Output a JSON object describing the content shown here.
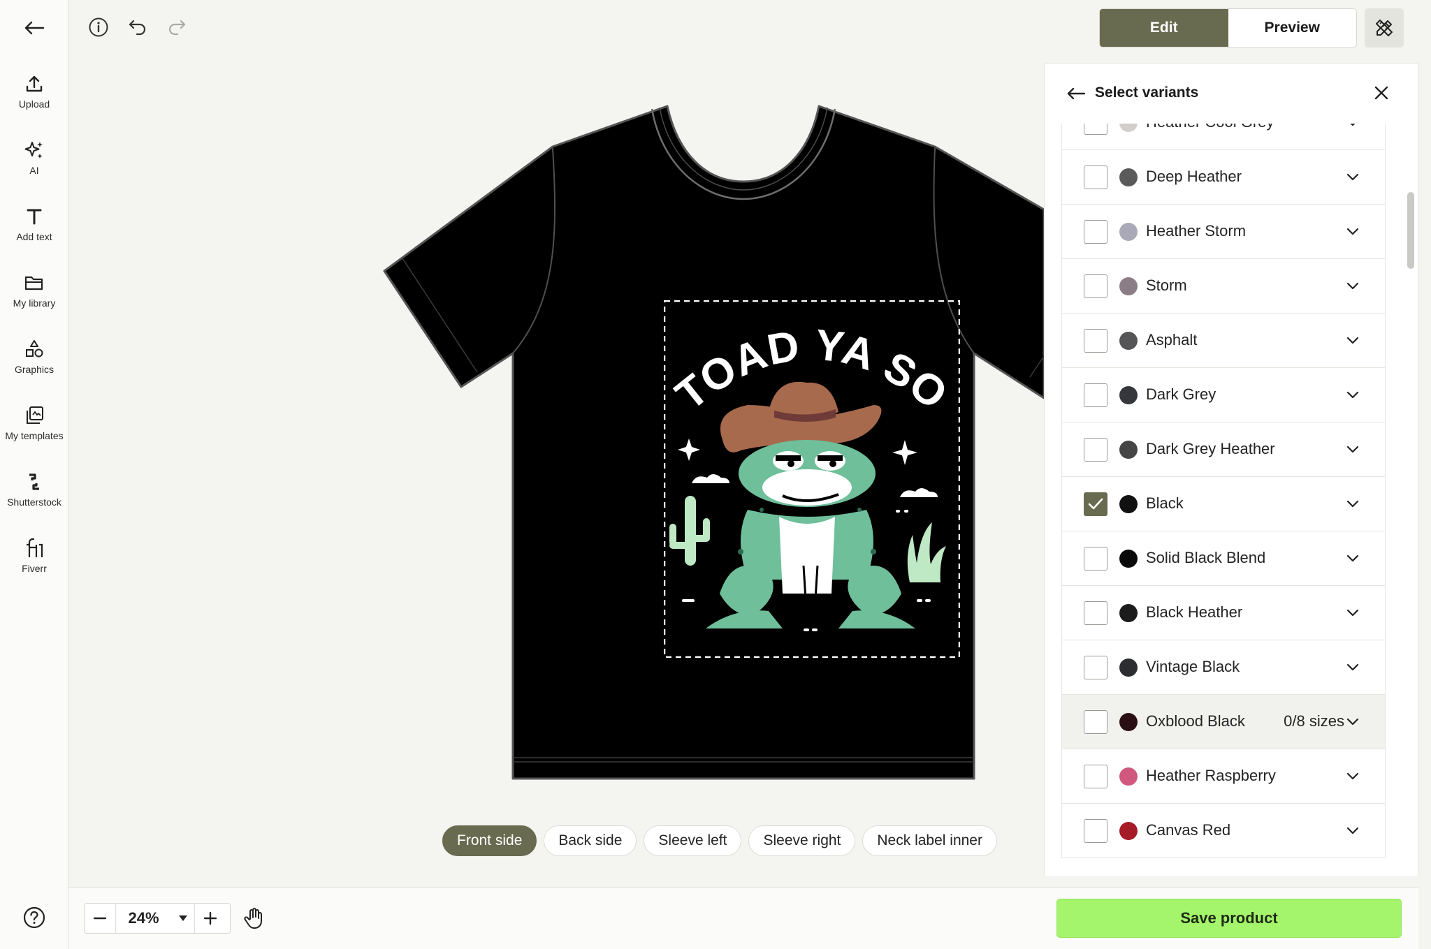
{
  "sidebar": {
    "back_label": "",
    "tools": [
      {
        "icon": "upload-icon",
        "label": "Upload"
      },
      {
        "icon": "ai-sparkle-icon",
        "label": "AI"
      },
      {
        "icon": "text-icon",
        "label": "Add text"
      },
      {
        "icon": "folder-icon",
        "label": "My library"
      },
      {
        "icon": "shapes-icon",
        "label": "Graphics"
      },
      {
        "icon": "templates-icon",
        "label": "My templates"
      },
      {
        "icon": "shutterstock-icon",
        "label": "Shutterstock"
      },
      {
        "icon": "fiverr-icon",
        "label": "Fiverr"
      }
    ]
  },
  "toolbar": {
    "edit_label": "Edit",
    "preview_label": "Preview",
    "active_mode": "Edit"
  },
  "design": {
    "headline": "TOAD YA SO"
  },
  "side_tabs": [
    "Front side",
    "Back side",
    "Sleeve left",
    "Sleeve right",
    "Neck label inner"
  ],
  "active_side_tab": "Front side",
  "variants_panel": {
    "title": "Select variants",
    "items": [
      {
        "name": "Heather Cool Grey",
        "color": "#d3ceca",
        "checked": false,
        "sizes": ""
      },
      {
        "name": "Deep Heather",
        "color": "#5a5a5a",
        "checked": false,
        "sizes": ""
      },
      {
        "name": "Heather Storm",
        "color": "#a9a9b8",
        "checked": false,
        "sizes": ""
      },
      {
        "name": "Storm",
        "color": "#8b7d86",
        "checked": false,
        "sizes": ""
      },
      {
        "name": "Asphalt",
        "color": "#555557",
        "checked": false,
        "sizes": ""
      },
      {
        "name": "Dark Grey",
        "color": "#36373c",
        "checked": false,
        "sizes": ""
      },
      {
        "name": "Dark Grey Heather",
        "color": "#454545",
        "checked": false,
        "sizes": ""
      },
      {
        "name": "Black",
        "color": "#111111",
        "checked": true,
        "sizes": ""
      },
      {
        "name": "Solid Black Blend",
        "color": "#0a0a0a",
        "checked": false,
        "sizes": ""
      },
      {
        "name": "Black Heather",
        "color": "#1c1c1c",
        "checked": false,
        "sizes": ""
      },
      {
        "name": "Vintage Black",
        "color": "#2b2d31",
        "checked": false,
        "sizes": ""
      },
      {
        "name": "Oxblood Black",
        "color": "#2a1014",
        "checked": false,
        "sizes": "0/8 sizes"
      },
      {
        "name": "Heather Raspberry",
        "color": "#d0587f",
        "checked": false,
        "sizes": ""
      },
      {
        "name": "Canvas Red",
        "color": "#a61b28",
        "checked": false,
        "sizes": ""
      }
    ]
  },
  "zoom": {
    "value": "24%"
  },
  "save_label": "Save product",
  "colors": {
    "accent": "#686b4f",
    "save": "#a4f56c",
    "shirt": "#000000"
  }
}
